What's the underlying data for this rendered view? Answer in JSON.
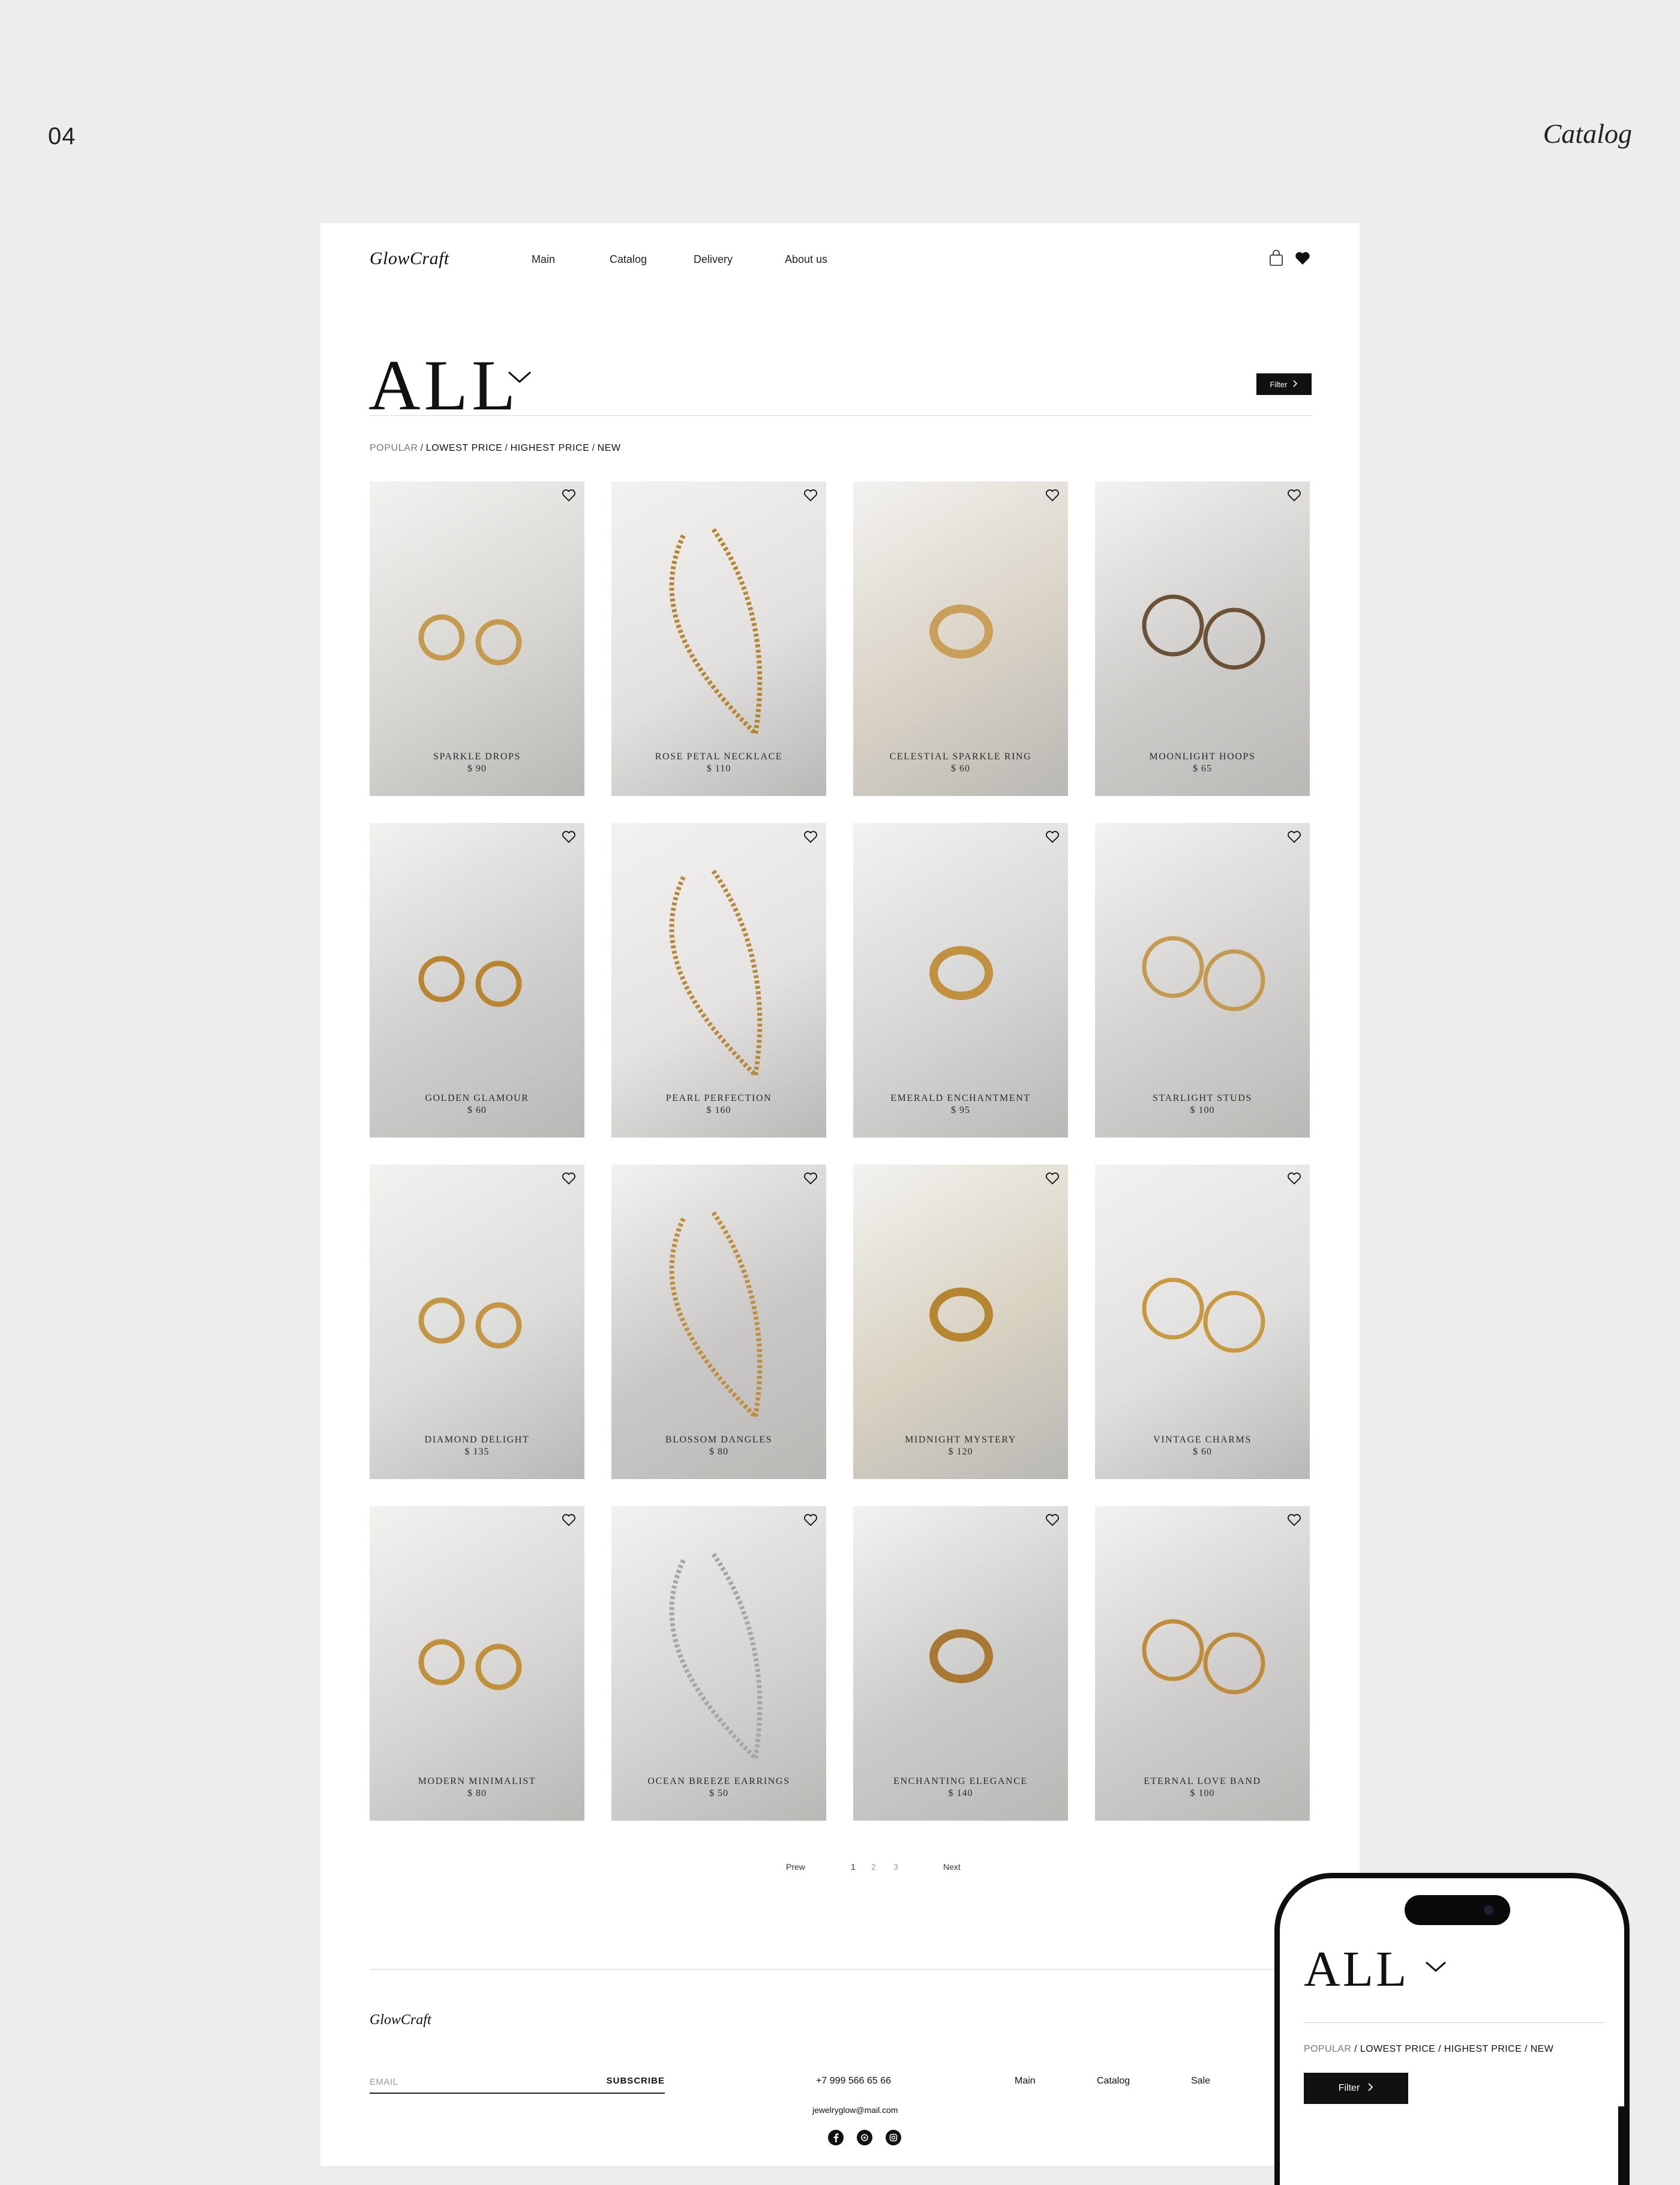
{
  "slide": {
    "number": "04",
    "title": "Catalog"
  },
  "site": {
    "logo": "GlowCraft",
    "nav": [
      "Main",
      "Catalog",
      "Delivery",
      "About us"
    ],
    "icons": [
      "bag-icon",
      "heart-filled-icon"
    ]
  },
  "catalog": {
    "heading": "ALL",
    "filter_label": "Filter",
    "sort": [
      "POPULAR",
      "LOWEST PRICE",
      "HIGHEST PRICE",
      "NEW"
    ],
    "products": [
      {
        "name": "SPARKLE DROPS",
        "price": "$ 90",
        "bg": "#d8d6d2",
        "accent": "#c59a4c"
      },
      {
        "name": "ROSE PETAL NECKLACE",
        "price": "$ 110",
        "bg": "#e2e1df",
        "accent": "#b8862f"
      },
      {
        "name": "CELESTIAL SPARKLE RING",
        "price": "$ 60",
        "bg": "#d9d2c6",
        "accent": "#c8a05a"
      },
      {
        "name": "MOONLIGHT HOOPS",
        "price": "$ 65",
        "bg": "#cfcdca",
        "accent": "#6b5136"
      },
      {
        "name": "GOLDEN GLAMOUR",
        "price": "$ 60",
        "bg": "#cfcfcf",
        "accent": "#b98530"
      },
      {
        "name": "PEARL PERFECTION",
        "price": "$ 160",
        "bg": "#e4e3e1",
        "accent": "#b98a3c"
      },
      {
        "name": "EMERALD ENCHANTMENT",
        "price": "$ 95",
        "bg": "#d6d6d6",
        "accent": "#c1913f"
      },
      {
        "name": "STARLIGHT STUDS",
        "price": "$ 100",
        "bg": "#d3d2d0",
        "accent": "#c49a50"
      },
      {
        "name": "DIAMOND DELIGHT",
        "price": "$ 135",
        "bg": "#dcdcdb",
        "accent": "#c39545"
      },
      {
        "name": "BLOSSOM DANGLES",
        "price": "$ 80",
        "bg": "#c9c8c6",
        "accent": "#c08f3c"
      },
      {
        "name": "MIDNIGHT MYSTERY",
        "price": "$ 120",
        "bg": "#d8d2c2",
        "accent": "#b5852f"
      },
      {
        "name": "VINTAGE CHARMS",
        "price": "$ 60",
        "bg": "#e0e0df",
        "accent": "#c9993f"
      },
      {
        "name": "MODERN MINIMALIST",
        "price": "$ 80",
        "bg": "#d7d6d4",
        "accent": "#c1903b"
      },
      {
        "name": "OCEAN BREEZE EARRINGS",
        "price": "$ 50",
        "bg": "#d5d4d2",
        "accent": "#a7a7a7"
      },
      {
        "name": "ENCHANTING ELEGANCE",
        "price": "$ 140",
        "bg": "#cbcbca",
        "accent": "#a97832"
      },
      {
        "name": "ETERNAL LOVE BAND",
        "price": "$ 100",
        "bg": "#cfcecc",
        "accent": "#c08c39"
      }
    ],
    "pagination": {
      "prev": "Prew",
      "pages": [
        "1",
        "2",
        "3"
      ],
      "next": "Next"
    }
  },
  "footer": {
    "logo": "GlowCraft",
    "email_placeholder": "EMAIL",
    "subscribe": "SUBSCRIBE",
    "phone": "+7 999 566 65 66",
    "email": "jewelryglow@mail.com",
    "links": [
      "Main",
      "Catalog",
      "Sale"
    ],
    "socials": [
      "facebook-icon",
      "vk-icon",
      "instagram-icon"
    ]
  },
  "mobile": {
    "heading": "ALL",
    "sort": [
      "POPULAR",
      "LOWEST PRICE",
      "HIGHEST PRICE",
      "NEW"
    ],
    "filter_label": "Filter"
  }
}
